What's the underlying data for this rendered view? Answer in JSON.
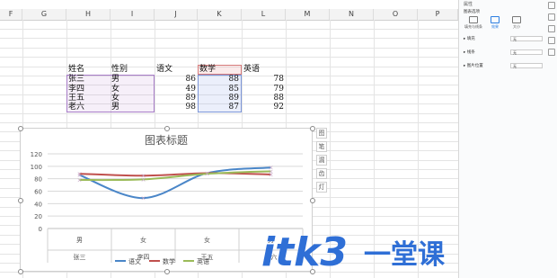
{
  "columns": [
    "F",
    "G",
    "H",
    "I",
    "J",
    "K",
    "L",
    "M",
    "N",
    "O",
    "P"
  ],
  "table": {
    "headers": [
      "姓名",
      "性别",
      "语文",
      "数学",
      "英语"
    ],
    "rows": [
      {
        "name": "张三",
        "gender": "男",
        "chinese": "86",
        "math": "88",
        "english": "78"
      },
      {
        "name": "李四",
        "gender": "女",
        "chinese": "49",
        "math": "85",
        "english": "79"
      },
      {
        "name": "王五",
        "gender": "女",
        "chinese": "89",
        "math": "89",
        "english": "88"
      },
      {
        "name": "老六",
        "gender": "男",
        "chinese": "98",
        "math": "87",
        "english": "92"
      }
    ]
  },
  "chart_data": {
    "type": "line",
    "title": "图表标题",
    "categories": [
      [
        "男",
        "张三"
      ],
      [
        "女",
        "李四"
      ],
      [
        "女",
        "王五"
      ],
      [
        "男",
        "老六"
      ]
    ],
    "series": [
      {
        "name": "语文",
        "values": [
          86,
          49,
          89,
          98
        ],
        "color": "#4a86c8"
      },
      {
        "name": "数学",
        "values": [
          88,
          85,
          89,
          87
        ],
        "color": "#c0504d"
      },
      {
        "name": "英语",
        "values": [
          78,
          79,
          88,
          92
        ],
        "color": "#9bbb59"
      }
    ],
    "ylim": [
      0,
      120
    ],
    "yticks": [
      "0",
      "20",
      "40",
      "60",
      "80",
      "100",
      "120"
    ],
    "grid": true,
    "legend_position": "bottom",
    "smooth": true
  },
  "chart_tools": [
    "图",
    "笔",
    "漏",
    "齿",
    "灯"
  ],
  "panel": {
    "title": "属性",
    "subtitle": "图表选项",
    "tabs": [
      {
        "label": "填充与线条"
      },
      {
        "label": "效果"
      },
      {
        "label": "大小"
      }
    ],
    "rows": [
      {
        "label": "▸ 填充",
        "value": "无"
      },
      {
        "label": "▸ 线条",
        "value": "无"
      },
      {
        "label": "▸ 图片位置",
        "value": "无"
      }
    ]
  },
  "watermark": {
    "text": "itk3",
    "cn": "一堂课",
    "color": "#2f6fd6"
  }
}
